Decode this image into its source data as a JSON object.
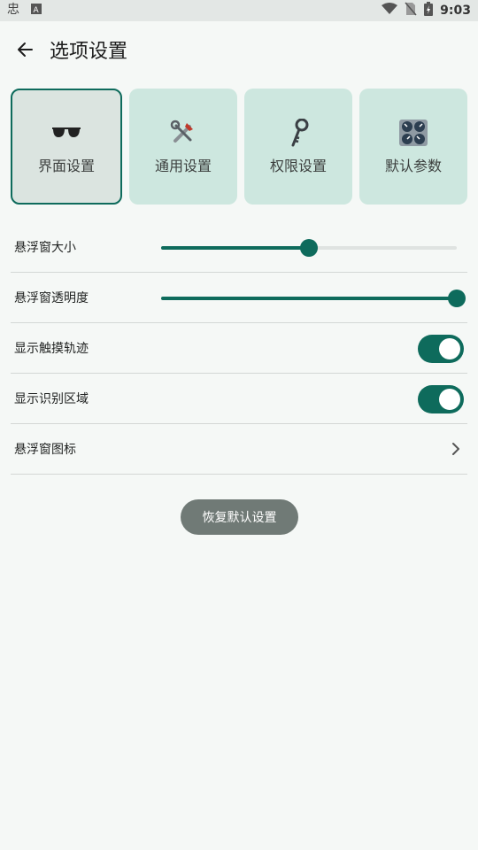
{
  "status_bar": {
    "left_icons": [
      "app-notification-icon",
      "text-a-icon"
    ],
    "time": "9:03",
    "right_icons": [
      "wifi-icon",
      "no-sim-icon",
      "battery-charging-icon"
    ]
  },
  "header": {
    "title": "选项设置",
    "back_icon": "arrow-back-icon"
  },
  "tabs": [
    {
      "label": "界面设置",
      "icon": "sunglasses-icon",
      "active": true
    },
    {
      "label": "通用设置",
      "icon": "tools-icon",
      "active": false
    },
    {
      "label": "权限设置",
      "icon": "key-icon",
      "active": false
    },
    {
      "label": "默认参数",
      "icon": "control-knobs-icon",
      "active": false
    }
  ],
  "settings": {
    "size": {
      "label": "悬浮窗大小",
      "value": 0.5
    },
    "opacity": {
      "label": "悬浮窗透明度",
      "value": 1.0
    },
    "touch_trail": {
      "label": "显示触摸轨迹",
      "enabled": true
    },
    "recognition_area": {
      "label": "显示识别区域",
      "enabled": true
    },
    "icon": {
      "label": "悬浮窗图标"
    }
  },
  "reset_button": {
    "label": "恢复默认设置"
  },
  "colors": {
    "accent": "#0e6b5c",
    "tab_bg": "#cde7df",
    "button_bg": "#707a76"
  }
}
